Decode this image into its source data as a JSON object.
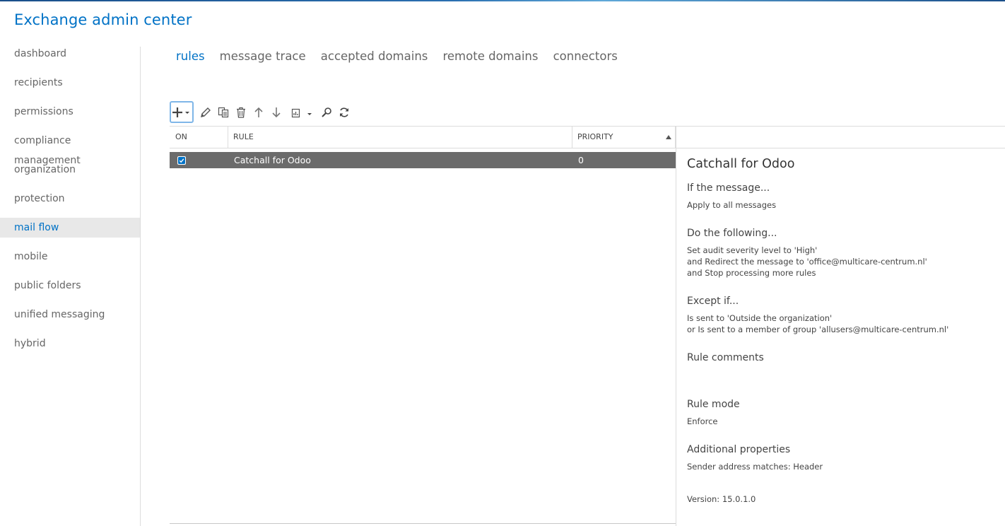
{
  "app": {
    "title": "Exchange admin center"
  },
  "nav": {
    "items": [
      {
        "label": "dashboard"
      },
      {
        "label": "recipients"
      },
      {
        "label": "permissions"
      },
      {
        "label": "compliance management"
      },
      {
        "label": "organization"
      },
      {
        "label": "protection"
      },
      {
        "label": "mail flow",
        "active": true
      },
      {
        "label": "mobile"
      },
      {
        "label": "public folders"
      },
      {
        "label": "unified messaging"
      },
      {
        "label": "hybrid"
      }
    ]
  },
  "tabs": [
    {
      "label": "rules",
      "active": true
    },
    {
      "label": "message trace"
    },
    {
      "label": "accepted domains"
    },
    {
      "label": "remote domains"
    },
    {
      "label": "connectors"
    }
  ],
  "toolbar": {
    "buttons": [
      "plus-icon",
      "pencil-icon",
      "copy-icon",
      "trash-icon",
      "arrow-up-icon",
      "arrow-down-icon",
      "report-icon",
      "search-icon",
      "refresh-icon"
    ]
  },
  "grid": {
    "columns": {
      "on": "ON",
      "rule": "RULE",
      "priority": "PRIORITY"
    },
    "sort": "priority-ascending",
    "rows": [
      {
        "on": true,
        "rule": "Catchall for Odoo",
        "priority": "0",
        "selected": true
      }
    ]
  },
  "details": {
    "title": "Catchall for Odoo",
    "if_heading": "If the message...",
    "if_lines": [
      "Apply to all messages"
    ],
    "do_heading": "Do the following...",
    "do_lines": [
      "Set audit severity level to 'High'",
      "and Redirect the message to 'office@multicare-centrum.nl'",
      "and Stop processing more rules"
    ],
    "except_heading": "Except if...",
    "except_lines": [
      "Is sent to 'Outside the organization'",
      "or Is sent to a member of group 'allusers@multicare-centrum.nl'"
    ],
    "comments_heading": "Rule comments",
    "mode_heading": "Rule mode",
    "mode_value": "Enforce",
    "props_heading": "Additional properties",
    "props_value": "Sender address matches: Header",
    "version": "Version: 15.0.1.0"
  },
  "colors": {
    "accent": "#0072c6",
    "selected_row": "#6b6b6b",
    "checkbox": "#0072c6"
  }
}
